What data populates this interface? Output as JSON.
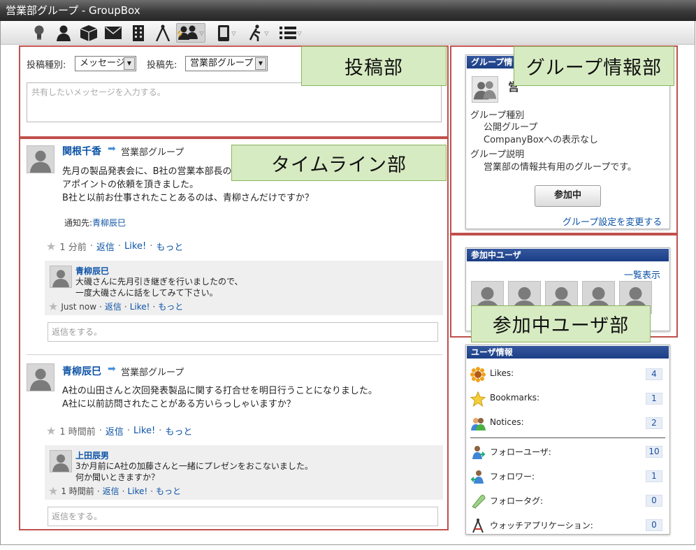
{
  "window": {
    "title": "営業部グループ - GroupBox"
  },
  "compose": {
    "type_label": "投稿種別:",
    "type_value": "メッセージ",
    "dest_label": "投稿先:",
    "dest_value": "営業部グループ",
    "placeholder": "共有したいメッセージを入力する。"
  },
  "callouts": {
    "compose": "投稿部",
    "timeline": "タイムライン部",
    "group_info": "グループ情報部",
    "members": "参加中ユーザ部"
  },
  "posts": [
    {
      "author": "関根千香",
      "arrow": "➡",
      "group": "営業部グループ",
      "lines": [
        "先月の製品発表会に、B社の営業本部長の",
        "アポイントの依頼を頂きました。",
        "B社と以前お仕事されたことあるのは、青柳さんだけですか？"
      ],
      "notify_label": "通知先:",
      "notify_user": "青柳辰巳",
      "time": "1 分前",
      "reply_label": "返信",
      "like_label": "Like!",
      "more_label": "もっと",
      "dot": "·",
      "reply": {
        "author": "青柳辰巳",
        "lines": [
          "大磯さんに先月引き継ぎを行いましたので、",
          "一度大磯さんに話をしてみて下さい。"
        ],
        "time": "Just now"
      },
      "reply_placeholder": "返信をする。"
    },
    {
      "author": "青柳辰巳",
      "arrow": "➡",
      "group": "営業部グループ",
      "lines": [
        "A社の山田さんと次回発表製品に関する打合せを明日行うことになりました。",
        "A社に以前訪問されたことがある方いらっしゃいますか？"
      ],
      "time": "1 時間前",
      "reply_label": "返信",
      "like_label": "Like!",
      "more_label": "もっと",
      "dot": "·",
      "reply": {
        "author": "上田辰男",
        "lines": [
          "3か月前にA社の加藤さんと一緒にプレゼンをおこないました。",
          "何か聞いときますか？"
        ],
        "time": "1 時間前"
      },
      "reply_placeholder": "返信をする。"
    }
  ],
  "group_info": {
    "header": "グループ情",
    "name_partial": "営",
    "type_label": "グループ種別",
    "type_value1": "公開グループ",
    "type_value2": "CompanyBoxへの表示なし",
    "desc_label": "グループ説明",
    "desc_value": "営業部の情報共有用のグループです。",
    "join_button": "参加中",
    "settings_link": "グループ設定を変更する"
  },
  "members": {
    "header": "参加中ユーザ",
    "list_link": "一覧表示"
  },
  "user_info": {
    "header": "ユーザ情報",
    "items": [
      {
        "icon": "sunflower-icon",
        "label": "Likes:",
        "count": "4"
      },
      {
        "icon": "star-icon",
        "label": "Bookmarks:",
        "count": "1"
      },
      {
        "icon": "people-icon",
        "label": "Notices:",
        "count": "2"
      },
      {
        "icon": "follow-user-icon",
        "label": "フォローユーザ:",
        "count": "10"
      },
      {
        "icon": "follower-icon",
        "label": "フォロワー:",
        "count": "1"
      },
      {
        "icon": "tag-icon",
        "label": "フォロータグ:",
        "count": "0"
      },
      {
        "icon": "compass-icon",
        "label": "ウォッチアプリケーション:",
        "count": "0"
      }
    ]
  },
  "colors": {
    "accent": "#0c53a6",
    "panel_header": "#1b3e86",
    "region_border": "#c0504d",
    "callout_bg": "#d7ebc2"
  }
}
